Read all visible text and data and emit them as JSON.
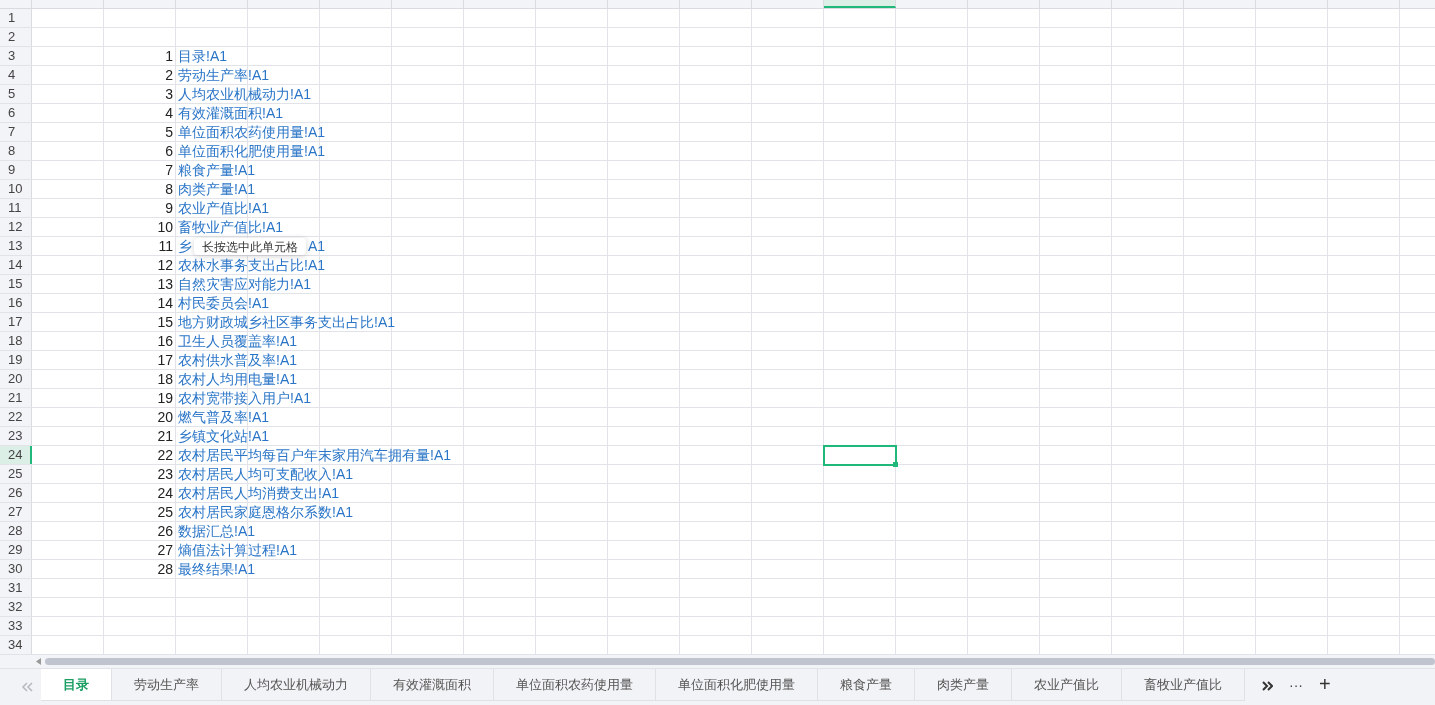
{
  "columns": [
    {
      "selected": false
    },
    {
      "selected": false
    },
    {
      "selected": false
    },
    {
      "selected": false
    },
    {
      "selected": false
    },
    {
      "selected": false
    },
    {
      "selected": false
    },
    {
      "selected": false
    },
    {
      "selected": false
    },
    {
      "selected": false
    },
    {
      "selected": false
    },
    {
      "selected": true
    },
    {
      "selected": false
    },
    {
      "selected": false
    },
    {
      "selected": false
    },
    {
      "selected": false
    },
    {
      "selected": false
    },
    {
      "selected": false
    },
    {
      "selected": false
    },
    {
      "selected": false
    }
  ],
  "rows": [
    {
      "number": "1",
      "selected": false
    },
    {
      "number": "2",
      "selected": false
    },
    {
      "number": "3",
      "selected": false,
      "index": "1",
      "link": "目录!A1"
    },
    {
      "number": "4",
      "selected": false,
      "index": "2",
      "link": "劳动生产率!A1"
    },
    {
      "number": "5",
      "selected": false,
      "index": "3",
      "link": "人均农业机械动力!A1"
    },
    {
      "number": "6",
      "selected": false,
      "index": "4",
      "link": "有效灌溉面积!A1"
    },
    {
      "number": "7",
      "selected": false,
      "index": "5",
      "link": "单位面积农药使用量!A1"
    },
    {
      "number": "8",
      "selected": false,
      "index": "6",
      "link": "单位面积化肥使用量!A1"
    },
    {
      "number": "9",
      "selected": false,
      "index": "7",
      "link": "粮食产量!A1"
    },
    {
      "number": "10",
      "selected": false,
      "index": "8",
      "link": "肉类产量!A1"
    },
    {
      "number": "11",
      "selected": false,
      "index": "9",
      "link": "农业产值比!A1"
    },
    {
      "number": "12",
      "selected": false,
      "index": "10",
      "link": "畜牧业产值比!A1"
    },
    {
      "number": "13",
      "selected": false,
      "index": "11",
      "link": "乡",
      "link_end": "A1"
    },
    {
      "number": "14",
      "selected": false,
      "index": "12",
      "link": "农林水事务支出占比!A1"
    },
    {
      "number": "15",
      "selected": false,
      "index": "13",
      "link": "自然灾害应对能力!A1"
    },
    {
      "number": "16",
      "selected": false,
      "index": "14",
      "link": "村民委员会!A1"
    },
    {
      "number": "17",
      "selected": false,
      "index": "15",
      "link": "地方财政城乡社区事务支出占比!A1"
    },
    {
      "number": "18",
      "selected": false,
      "index": "16",
      "link": "卫生人员覆盖率!A1"
    },
    {
      "number": "19",
      "selected": false,
      "index": "17",
      "link": "农村供水普及率!A1"
    },
    {
      "number": "20",
      "selected": false,
      "index": "18",
      "link": "农村人均用电量!A1"
    },
    {
      "number": "21",
      "selected": false,
      "index": "19",
      "link": "农村宽带接入用户!A1"
    },
    {
      "number": "22",
      "selected": false,
      "index": "20",
      "link": "燃气普及率!A1"
    },
    {
      "number": "23",
      "selected": false,
      "index": "21",
      "link": "乡镇文化站!A1"
    },
    {
      "number": "24",
      "selected": true,
      "index": "22",
      "link": "农村居民平均每百户年末家用汽车拥有量!A1"
    },
    {
      "number": "25",
      "selected": false,
      "index": "23",
      "link": "农村居民人均可支配收入!A1"
    },
    {
      "number": "26",
      "selected": false,
      "index": "24",
      "link": "农村居民人均消费支出!A1"
    },
    {
      "number": "27",
      "selected": false,
      "index": "25",
      "link": "农村居民家庭恩格尔系数!A1"
    },
    {
      "number": "28",
      "selected": false,
      "index": "26",
      "link": "数据汇总!A1"
    },
    {
      "number": "29",
      "selected": false,
      "index": "27",
      "link": "熵值法计算过程!A1"
    },
    {
      "number": "30",
      "selected": false,
      "index": "28",
      "link": "最终结果!A1"
    },
    {
      "number": "31",
      "selected": false
    },
    {
      "number": "32",
      "selected": false
    },
    {
      "number": "33",
      "selected": false
    },
    {
      "number": "34",
      "selected": false
    }
  ],
  "tooltip": {
    "text": "长按选中此单元格"
  },
  "sheet_tabs": [
    {
      "label": "目录",
      "selected": true
    },
    {
      "label": "劳动生产率",
      "selected": false
    },
    {
      "label": "人均农业机械动力",
      "selected": false
    },
    {
      "label": "有效灌溉面积",
      "selected": false
    },
    {
      "label": "单位面积农药使用量",
      "selected": false
    },
    {
      "label": "单位面积化肥使用量",
      "selected": false
    },
    {
      "label": "粮食产量",
      "selected": false
    },
    {
      "label": "肉类产量",
      "selected": false
    },
    {
      "label": "农业产值比",
      "selected": false
    },
    {
      "label": "畜牧业产值比",
      "selected": false
    }
  ],
  "tab_controls": {
    "more": "···",
    "add": "+"
  }
}
